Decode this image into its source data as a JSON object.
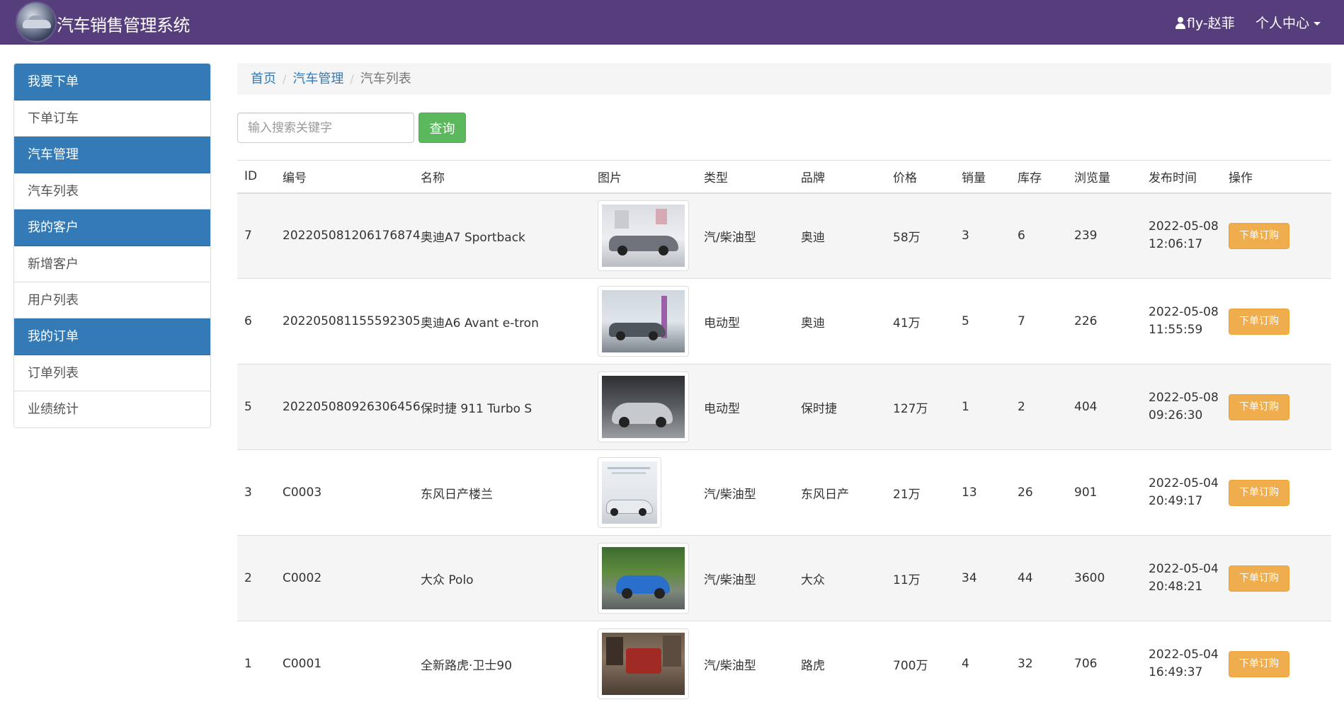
{
  "header": {
    "brand": "汽车销售管理系统",
    "user": "fly-赵菲",
    "personal_center": "个人中心",
    "nav_color": "#563d7c"
  },
  "sidebar": {
    "sections": [
      {
        "heading": "我要下单",
        "items": [
          "下单订车"
        ]
      },
      {
        "heading": "汽车管理",
        "items": [
          "汽车列表"
        ]
      },
      {
        "heading": "我的客户",
        "items": [
          "新增客户",
          "用户列表"
        ]
      },
      {
        "heading": "我的订单",
        "items": [
          "订单列表",
          "业绩统计"
        ]
      }
    ]
  },
  "breadcrumb": {
    "home": "首页",
    "sep": "/",
    "car_mgmt": "汽车管理",
    "current": "汽车列表"
  },
  "search": {
    "placeholder": "输入搜索关键字",
    "button": "查询"
  },
  "table": {
    "headers": [
      "ID",
      "编号",
      "名称",
      "图片",
      "类型",
      "品牌",
      "价格",
      "销量",
      "库存",
      "浏览量",
      "发布时间",
      "操作"
    ],
    "rows": [
      {
        "id": "7",
        "code": "202205081206176874",
        "name": "奥迪A7 Sportback",
        "type": "汽/柴油型",
        "brand": "奥迪",
        "price": "58万",
        "sales": "3",
        "stock": "6",
        "views": "239",
        "date": "2022-05-08",
        "time": "12:06:17",
        "action": "下单订购"
      },
      {
        "id": "6",
        "code": "202205081155592305",
        "name": "奥迪A6 Avant e-tron",
        "type": "电动型",
        "brand": "奥迪",
        "price": "41万",
        "sales": "5",
        "stock": "7",
        "views": "226",
        "date": "2022-05-08",
        "time": "11:55:59",
        "action": "下单订购"
      },
      {
        "id": "5",
        "code": "202205080926306456",
        "name": "保时捷 911 Turbo S",
        "type": "电动型",
        "brand": "保时捷",
        "price": "127万",
        "sales": "1",
        "stock": "2",
        "views": "404",
        "date": "2022-05-08",
        "time": "09:26:30",
        "action": "下单订购"
      },
      {
        "id": "3",
        "code": "C0003",
        "name": "东风日产楼兰",
        "type": "汽/柴油型",
        "brand": "东风日产",
        "price": "21万",
        "sales": "13",
        "stock": "26",
        "views": "901",
        "date": "2022-05-04",
        "time": "20:49:17",
        "action": "下单订购"
      },
      {
        "id": "2",
        "code": "C0002",
        "name": "大众 Polo",
        "type": "汽/柴油型",
        "brand": "大众",
        "price": "11万",
        "sales": "34",
        "stock": "44",
        "views": "3600",
        "date": "2022-05-04",
        "time": "20:48:21",
        "action": "下单订购"
      },
      {
        "id": "1",
        "code": "C0001",
        "name": "全新路虎·卫士90",
        "type": "汽/柴油型",
        "brand": "路虎",
        "price": "700万",
        "sales": "4",
        "stock": "32",
        "views": "706",
        "date": "2022-05-04",
        "time": "16:49:37",
        "action": "下单订购"
      }
    ]
  },
  "colors": {
    "primary": "#337ab7",
    "success": "#5cb85c",
    "warning": "#f0ad4e"
  }
}
